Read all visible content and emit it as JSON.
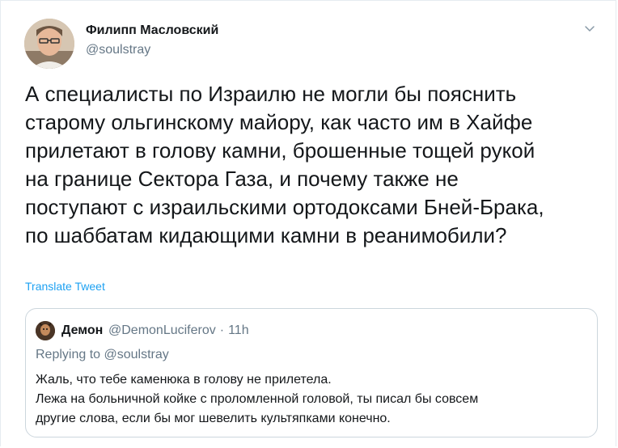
{
  "tweet": {
    "author_name": "Филипп Масловский",
    "author_handle": "@soulstray",
    "text": "А специалисты по Израилю не могли бы пояснить\nстарому ольгинскому майору, как часто им в Хайфе\nприлетают в голову камни, брошенные тощей рукой\nна границе Сектора Газа, и почему также не\nпоступают с израильскими ортодоксами Бней-Брака,\nпо шаббатам кидающими камни в реанимобили?",
    "translate_label": "Translate Tweet",
    "menu_icon": "chevron-down-icon"
  },
  "quoted_tweet": {
    "author_name": "Демон",
    "author_handle": "@DemonLuciferov",
    "separator": "·",
    "time": "11h",
    "replying_to": "Replying to @soulstray",
    "text": "Жаль, что тебе каменюка в голову не прилетела.\nЛежа на больничной койке с проломленной головой, ты писал бы совсем\nдругие слова, если бы мог шевелить культяпками конечно."
  },
  "colors": {
    "link": "#1da1f2",
    "secondary_text": "#657786",
    "border": "#ccd6dd"
  }
}
